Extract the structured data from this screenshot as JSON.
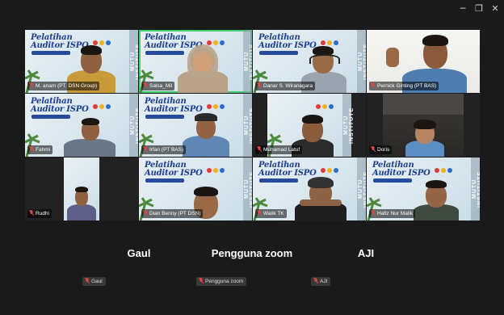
{
  "window_controls": {
    "minimize": "─",
    "restore": "❐",
    "close": "✕"
  },
  "slide": {
    "title_line1": "Pelatihan",
    "title_line2": "Auditor ISPO",
    "side_text": "MUTU INSTITUTE"
  },
  "colors": {
    "active_border": "#3ecf6e",
    "slide_title": "#1d3f8f",
    "background": "#1a1a1a",
    "mic_muted": "#e04646"
  },
  "participants": [
    {
      "name": "M. anam (PT. DSN Group)"
    },
    {
      "name": "Salsa_Mil"
    },
    {
      "name": "Danar S. Wiranagara"
    },
    {
      "name": "Pernick Ginting (PT BAS)"
    },
    {
      "name": "Fahmi"
    },
    {
      "name": "Irfan (PT BAS)"
    },
    {
      "name": "Muhamad Latuf"
    },
    {
      "name": "Doris"
    },
    {
      "name": "Rudhi"
    },
    {
      "name": "Dian Benny (PT DSN)"
    },
    {
      "name": "Walik TK"
    },
    {
      "name": "Hafiz Nur Malik"
    }
  ],
  "audio_only": [
    {
      "display": "Gaul",
      "label": "Gaul"
    },
    {
      "display": "Pengguna zoom",
      "label": "Pengguna zoom"
    },
    {
      "display": "AJI",
      "label": "AJI"
    }
  ]
}
